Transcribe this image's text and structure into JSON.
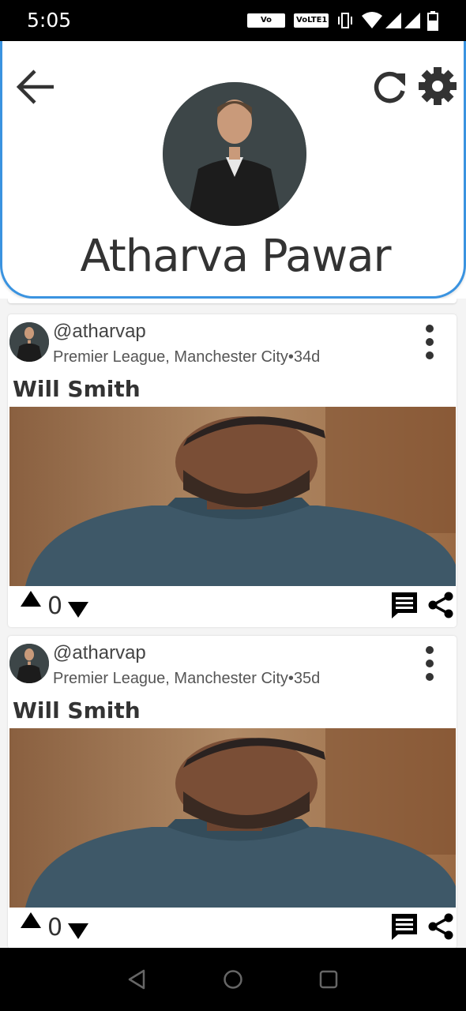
{
  "status_bar": {
    "time": "5:05",
    "wifi_badge": "Vo WiFi2",
    "volte_badge": "VoLTE1",
    "icons": [
      "vibrate-icon",
      "wifi-icon",
      "signal-icon",
      "signal-icon",
      "battery-icon"
    ]
  },
  "header": {
    "back_icon": "arrow-left-icon",
    "refresh_icon": "refresh-icon",
    "settings_icon": "gear-icon",
    "profile_name": "Atharva Pawar"
  },
  "posts": [
    {
      "handle": "@atharvap",
      "meta": "Premier League, Manchester City•34d",
      "title": "Will Smith",
      "votes": "0"
    },
    {
      "handle": "@atharvap",
      "meta": "Premier League, Manchester City•35d",
      "title": "Will Smith",
      "votes": "0"
    }
  ],
  "nav": {
    "buttons": [
      "back-triangle-icon",
      "home-circle-icon",
      "recents-square-icon"
    ]
  },
  "colors": {
    "accent": "#3a93e0",
    "text": "#333333"
  }
}
